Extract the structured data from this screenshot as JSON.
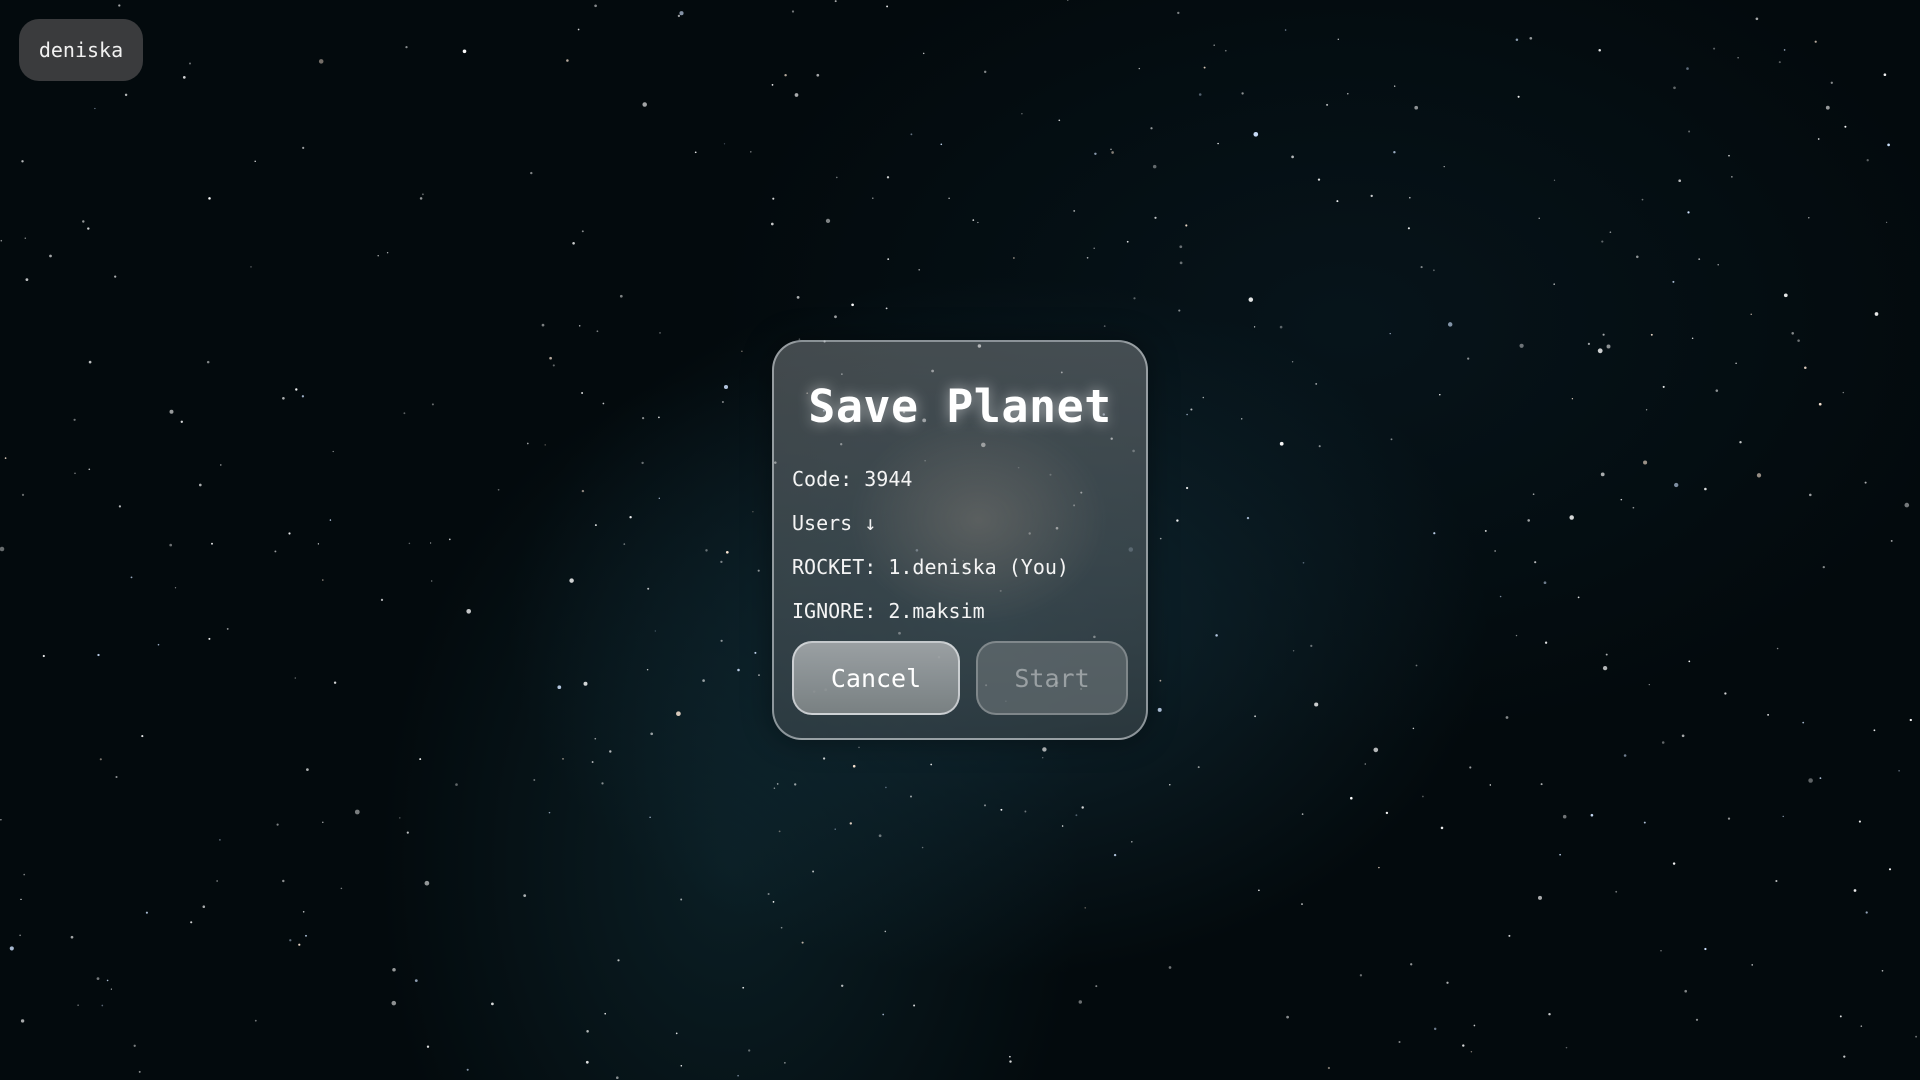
{
  "user_chip": {
    "label": "deniska"
  },
  "dialog": {
    "title": "Save Planet",
    "code_line": "Code: 3944",
    "users_header": "Users ↓",
    "users": [
      {
        "text": "ROCKET: 1.deniska (You)"
      },
      {
        "text": "IGNORE: 2.maksim"
      }
    ],
    "buttons": {
      "cancel_label": "Cancel",
      "start_label": "Start"
    }
  }
}
